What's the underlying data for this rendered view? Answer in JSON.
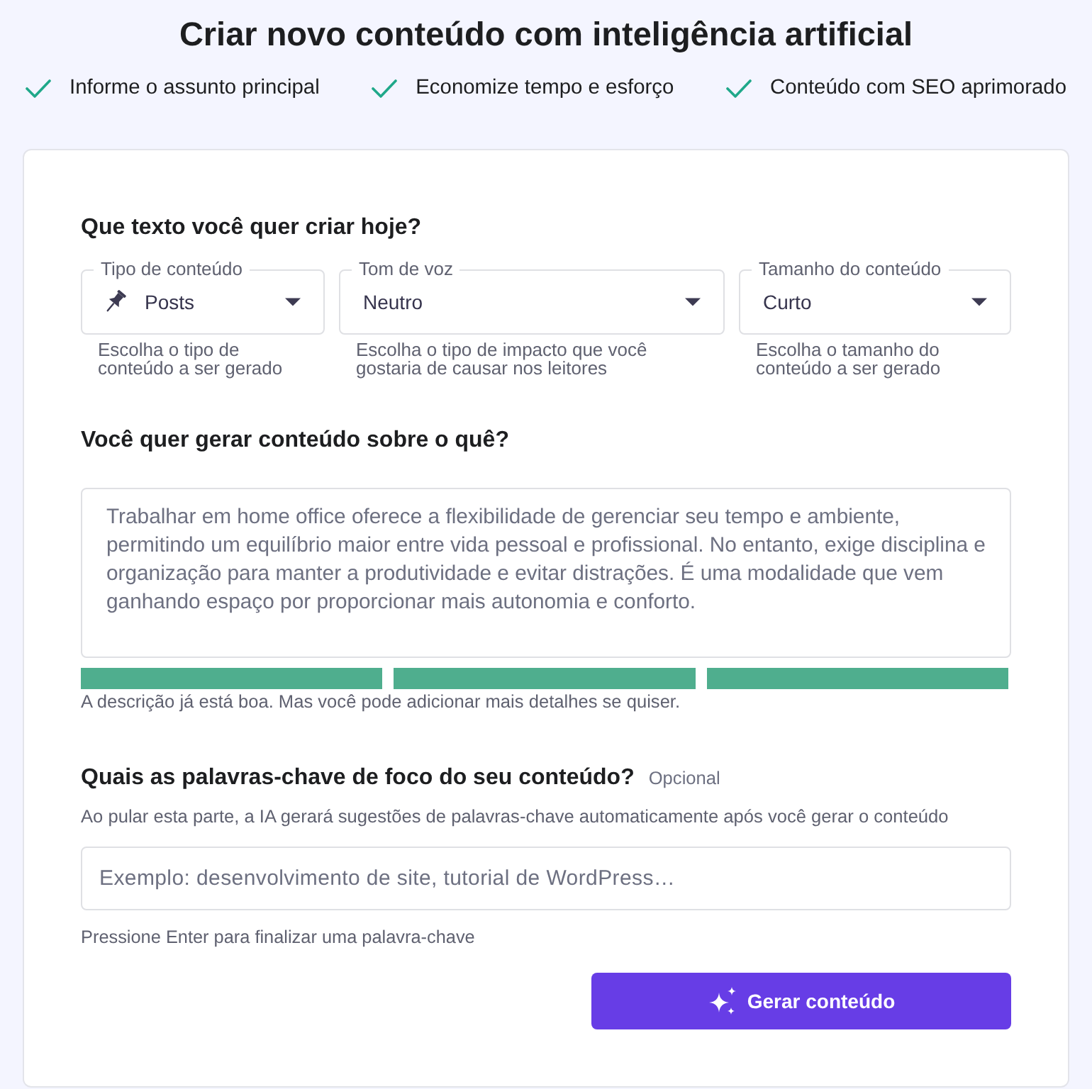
{
  "title": "Criar novo conteúdo com inteligência artificial",
  "benefits": [
    "Informe o assunto principal",
    "Economize tempo e esforço",
    "Conteúdo com SEO aprimorado"
  ],
  "form": {
    "content_settings": {
      "heading": "Que texto você quer criar hoje?",
      "selects": [
        {
          "kind": "icon",
          "label": "Tipo de conteúdo",
          "value": "Posts",
          "helper": "Escolha o tipo de conteúdo a ser gerado"
        },
        {
          "kind": "plain",
          "label": "Tom de voz",
          "value": "Neutro",
          "helper": "Escolha o tipo de impacto que você gostaria de causar nos leitores"
        },
        {
          "kind": "plain",
          "label": "Tamanho do conteúdo",
          "value": "Curto",
          "helper": "Escolha o tamanho do conteúdo a ser gerado"
        }
      ]
    },
    "description": {
      "heading": "Você quer gerar conteúdo sobre o quê?",
      "value": "Trabalhar em home office oferece a flexibilidade de gerenciar seu tempo e ambiente, permitindo um equilíbrio maior entre vida pessoal e profissional. No entanto, exige disciplina e organização para manter a produtividade e evitar distrações. É uma modalidade que vem ganhando espaço por proporcionar mais autonomia e conforto.",
      "meter": {
        "level": 1
      },
      "feedback": "A descrição já está boa. Mas você pode adicionar mais detalhes se quiser."
    },
    "keywords": {
      "heading": "Quais as palavras-chave de foco do seu conteúdo?",
      "optional_label": "Opcional",
      "note": "Ao pular esta parte, a IA gerará sugestões de palavras-chave automaticamente após você gerar o conteúdo",
      "placeholder": "Exemplo: desenvolvimento de site, tutorial de WordPress…",
      "hint": "Pressione Enter para finalizar uma palavra-chave"
    },
    "generate_button": {
      "label": "Gerar conteúdo"
    }
  }
}
